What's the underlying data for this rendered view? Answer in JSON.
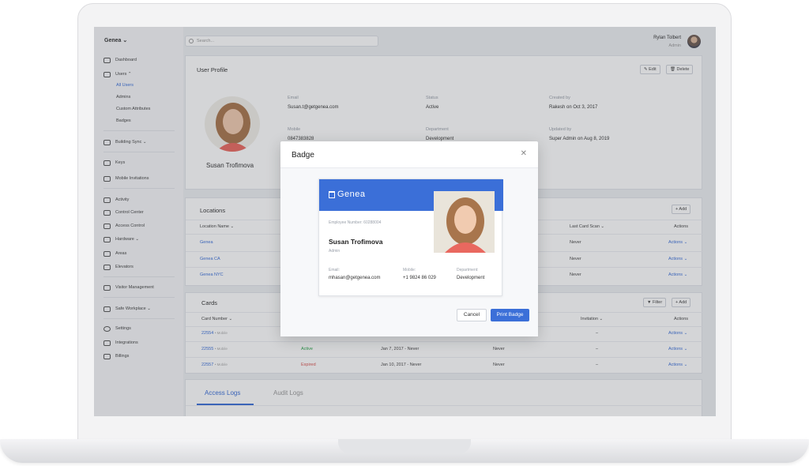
{
  "sidebar": {
    "org": "Genea ⌄",
    "items": [
      {
        "label": "Dashboard",
        "icon": "dashboard-icon"
      },
      {
        "label": "Users ⌃",
        "icon": "users-icon"
      },
      {
        "label": "Building Sync ⌄",
        "icon": "sync-icon"
      },
      {
        "label": "Keys",
        "icon": "key-icon"
      },
      {
        "label": "Mobile Invitations",
        "icon": "mobile-icon"
      },
      {
        "label": "Activity",
        "icon": "activity-icon"
      },
      {
        "label": "Control Center",
        "icon": "control-center-icon"
      },
      {
        "label": "Access Control",
        "icon": "lock-icon"
      },
      {
        "label": "Hardware ⌄",
        "icon": "hardware-icon"
      },
      {
        "label": "Areas",
        "icon": "areas-icon"
      },
      {
        "label": "Elevators",
        "icon": "elevator-icon"
      },
      {
        "label": "Visitor Management",
        "icon": "visitor-icon"
      },
      {
        "label": "Safe Workplace ⌄",
        "icon": "safe-workplace-icon"
      },
      {
        "label": "Settings",
        "icon": "gear-icon"
      },
      {
        "label": "Integrations",
        "icon": "integrations-icon"
      },
      {
        "label": "Billings",
        "icon": "billing-icon"
      }
    ],
    "users_sub": [
      "All Users",
      "Admins",
      "Custom Attributes",
      "Badges"
    ]
  },
  "topbar": {
    "search_placeholder": "Search...",
    "user_name": "Rylan Tolbert",
    "user_role": "Admin"
  },
  "profile": {
    "title": "User Profile",
    "edit": "✎ Edit",
    "delete": "🗑 Delete",
    "name": "Susan Trofimova",
    "email_label": "Email",
    "email": "Susan.t@getgenea.com",
    "status_label": "Status",
    "status": "Active",
    "created_label": "Created by",
    "created": "Rakesh on Oct 3, 2017",
    "mobile_label": "Mobile",
    "mobile": "0847383828",
    "department_label": "Department",
    "department": "Development",
    "updated_label": "Updated by",
    "updated": "Super Admin on Aug 8, 2019"
  },
  "locations": {
    "title": "Locations",
    "add": "+ Add",
    "col_name": "Location Name ⌄",
    "col_scan": "Last Card Scan ⌄",
    "col_actions": "Actions",
    "rows": [
      {
        "name": "Genea",
        "scan": "Never",
        "action": "Actions ⌄"
      },
      {
        "name": "Genea CA",
        "scan": "Never",
        "action": "Actions ⌄"
      },
      {
        "name": "Genea NYC",
        "scan": "Never",
        "action": "Actions ⌄"
      }
    ]
  },
  "cards": {
    "title": "Cards",
    "filter": "▼ Filter",
    "add": "+ Add",
    "col_number": "Card Number ⌄",
    "col_invitation": "Invitation ⌄",
    "col_actions": "Actions",
    "rows": [
      {
        "number": "22554",
        "tag": "• Mobile",
        "status": "",
        "period": "",
        "last": "",
        "invitation": "–",
        "action": "Actions ⌄"
      },
      {
        "number": "22555",
        "tag": "• Mobile",
        "status": "Active",
        "period": "Jan 7, 2017 - Never",
        "last": "Never",
        "invitation": "–",
        "action": "Actions ⌄"
      },
      {
        "number": "22557",
        "tag": "• Mobile",
        "status": "Expired",
        "period": "Jan 10, 2017 - Never",
        "last": "Never",
        "invitation": "–",
        "action": "Actions ⌄"
      }
    ]
  },
  "logs": {
    "tab_access": "Access Logs",
    "tab_audit": "Audit Logs"
  },
  "modal": {
    "title": "Badge",
    "close": "✕",
    "brand": "Genea",
    "employee_number": "Employee Number: 60288004",
    "name": "Susan Trofimova",
    "role": "Admin",
    "email_label": "Email:",
    "email": "mhasan@getgenea.com",
    "mobile_label": "Mobile:",
    "mobile": "+1 9824 86 029",
    "department_label": "Department:",
    "department": "Development",
    "cancel": "Cancel",
    "print": "Print Badge"
  },
  "colors": {
    "accent": "#3b6fd8",
    "active": "#29a34a",
    "expired": "#d9534f"
  }
}
